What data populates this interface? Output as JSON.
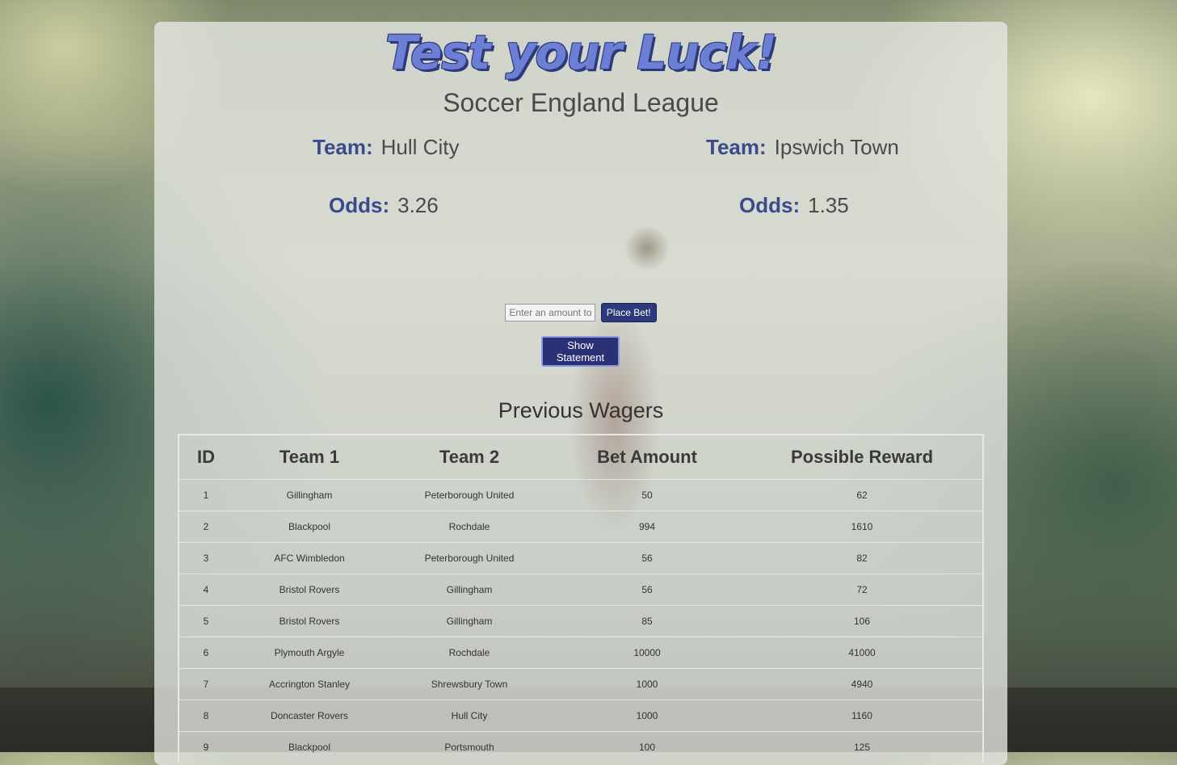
{
  "header": {
    "title": "Test your Luck!",
    "league": "Soccer England League"
  },
  "match": {
    "team_label": "Team:",
    "odds_label": "Odds:",
    "home": {
      "team": "Hull City",
      "odds": "3.26"
    },
    "away": {
      "team": "Ipswich Town",
      "odds": "1.35"
    }
  },
  "bet": {
    "amount_placeholder": "Enter an amount to place bet",
    "place_label": "Place Bet!",
    "statement_label": "Show Statement"
  },
  "wagers": {
    "title": "Previous Wagers",
    "columns": [
      "ID",
      "Team 1",
      "Team 2",
      "Bet Amount",
      "Possible Reward"
    ],
    "rows": [
      [
        "1",
        "Gillingham",
        "Peterborough United",
        "50",
        "62"
      ],
      [
        "2",
        "Blackpool",
        "Rochdale",
        "994",
        "1610"
      ],
      [
        "3",
        "AFC Wimbledon",
        "Peterborough United",
        "56",
        "82"
      ],
      [
        "4",
        "Bristol Rovers",
        "Gillingham",
        "56",
        "72"
      ],
      [
        "5",
        "Bristol Rovers",
        "Gillingham",
        "85",
        "106"
      ],
      [
        "6",
        "Plymouth Argyle",
        "Rochdale",
        "10000",
        "41000"
      ],
      [
        "7",
        "Accrington Stanley",
        "Shrewsbury Town",
        "1000",
        "4940"
      ],
      [
        "8",
        "Doncaster Rovers",
        "Hull City",
        "1000",
        "1160"
      ],
      [
        "9",
        "Blackpool",
        "Portsmouth",
        "100",
        "125"
      ]
    ]
  }
}
